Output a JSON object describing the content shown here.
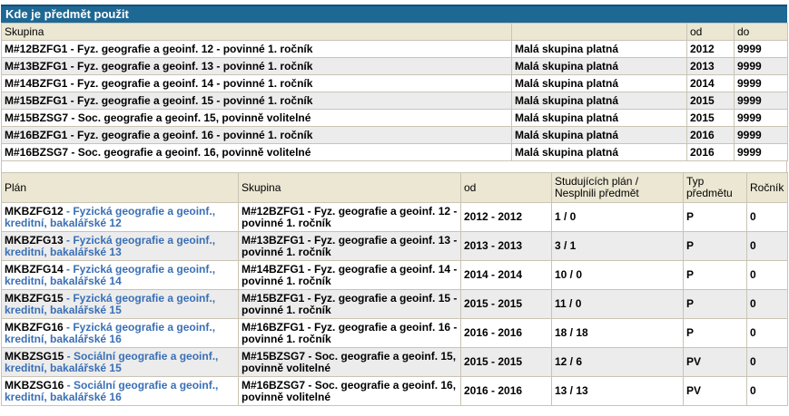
{
  "panel": {
    "title": "Kde je předmět použit"
  },
  "groups_table": {
    "headers": {
      "group": "Skupina",
      "valid": "",
      "from": "od",
      "to": "do"
    },
    "rows": [
      {
        "group": "M#12BZFG1 - Fyz. geografie a geoinf. 12 - povinné 1. ročník",
        "valid": "Malá skupina platná",
        "from": "2012",
        "to": "9999"
      },
      {
        "group": "M#13BZFG1 - Fyz. geografie a geoinf. 13 - povinné 1. ročník",
        "valid": "Malá skupina platná",
        "from": "2013",
        "to": "9999"
      },
      {
        "group": "M#14BZFG1 - Fyz. geografie a geoinf. 14 - povinné 1. ročník",
        "valid": "Malá skupina platná",
        "from": "2014",
        "to": "9999"
      },
      {
        "group": "M#15BZFG1 - Fyz. geografie a geoinf. 15 - povinné 1. ročník",
        "valid": "Malá skupina platná",
        "from": "2015",
        "to": "9999"
      },
      {
        "group": "M#15BZSG7 - Soc. geografie a geoinf. 15, povinně volitelné",
        "valid": "Malá skupina platná",
        "from": "2015",
        "to": "9999"
      },
      {
        "group": "M#16BZFG1 - Fyz. geografie a geoinf. 16 - povinné 1. ročník",
        "valid": "Malá skupina platná",
        "from": "2016",
        "to": "9999"
      },
      {
        "group": "M#16BZSG7 - Soc. geografie a geoinf. 16, povinně volitelné",
        "valid": "Malá skupina platná",
        "from": "2016",
        "to": "9999"
      }
    ]
  },
  "plans_table": {
    "headers": {
      "plan": "Plán",
      "group": "Skupina",
      "from": "od",
      "students": "Studujících plán / Nesplnili předmět",
      "type": "Typ předmětu",
      "year": "Ročník"
    },
    "rows": [
      {
        "code": "MKBZFG12",
        "sep": " - ",
        "name": "Fyzická geografie a geoinf., kreditní, bakalářské 12",
        "group": "M#12BZFG1 - Fyz. geografie a geoinf. 12 - povinné 1. ročník",
        "period": "2012 - 2012",
        "students": "1 / 0",
        "type": "P",
        "year": "0"
      },
      {
        "code": "MKBZFG13",
        "sep": " - ",
        "name": "Fyzická geografie a geoinf., kreditní, bakalářské 13",
        "group": "M#13BZFG1 - Fyz. geografie a geoinf. 13 - povinné 1. ročník",
        "period": "2013 - 2013",
        "students": "3 / 1",
        "type": "P",
        "year": "0"
      },
      {
        "code": "MKBZFG14",
        "sep": " - ",
        "name": "Fyzická geografie a geoinf., kreditní, bakalářské 14",
        "group": "M#14BZFG1 - Fyz. geografie a geoinf. 14 - povinné 1. ročník",
        "period": "2014 - 2014",
        "students": "10 / 0",
        "type": "P",
        "year": "0"
      },
      {
        "code": "MKBZFG15",
        "sep": " - ",
        "name": "Fyzická geografie a geoinf., kreditní, bakalářské 15",
        "group": "M#15BZFG1 - Fyz. geografie a geoinf. 15 - povinné 1. ročník",
        "period": "2015 - 2015",
        "students": "11 / 0",
        "type": "P",
        "year": "0"
      },
      {
        "code": "MKBZFG16",
        "sep": " - ",
        "name": "Fyzická geografie a geoinf., kreditní, bakalářské 16",
        "group": "M#16BZFG1 - Fyz. geografie a geoinf. 16 - povinné 1. ročník",
        "period": "2016 - 2016",
        "students": "18 / 18",
        "type": "P",
        "year": "0"
      },
      {
        "code": "MKBZSG15",
        "sep": " - ",
        "name": "Sociální geografie a geoinf., kreditní, bakalářské 15",
        "group": "M#15BZSG7 - Soc. geografie a geoinf. 15, povinně volitelné",
        "period": "2015 - 2015",
        "students": "12 / 6",
        "type": "PV",
        "year": "0"
      },
      {
        "code": "MKBZSG16",
        "sep": " - ",
        "name": "Sociální geografie a geoinf., kreditní, bakalářské 16",
        "group": "M#16BZSG7 - Soc. geografie a geoinf. 16, povinně volitelné",
        "period": "2016 - 2016",
        "students": "13 / 13",
        "type": "PV",
        "year": "0"
      }
    ]
  }
}
